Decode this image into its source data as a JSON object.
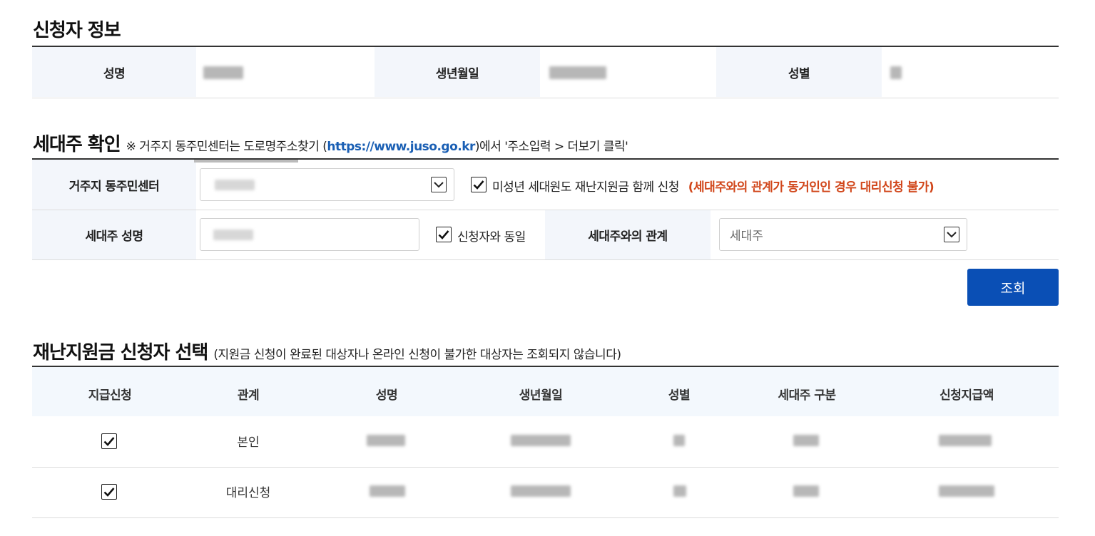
{
  "applicant": {
    "title": "신청자 정보",
    "name_label": "성명",
    "birth_label": "생년월일",
    "gender_label": "성별"
  },
  "household": {
    "title": "세대주 확인",
    "note_prefix": "※ 거주지 동주민센터는 도로명주소찾기 (",
    "note_link": "https://www.juso.go.kr",
    "note_suffix": ")에서 '주소입력 > 더보기 클릭'",
    "center_label": "거주지 동주민센터",
    "minor_check_label": "미성년 세대원도 재난지원금 함께 신청",
    "minor_warning": "(세대주와의 관계가 동거인인 경우 대리신청 불가)",
    "head_name_label": "세대주 성명",
    "same_as_applicant_label": "신청자와 동일",
    "relation_label": "세대주와의 관계",
    "relation_value": "세대주",
    "search_button": "조회"
  },
  "selection": {
    "title": "재난지원금 신청자 선택",
    "note": "(지원금 신청이 완료된 대상자나 온라인 신청이 불가한 대상자는 조회되지 않습니다)",
    "columns": [
      "지급신청",
      "관계",
      "성명",
      "생년월일",
      "성별",
      "세대주 구분",
      "신청지급액"
    ],
    "rows": [
      {
        "relation": "본인",
        "checked": true
      },
      {
        "relation": "대리신청",
        "checked": true
      }
    ]
  },
  "colors": {
    "accent": "#0a4fb5",
    "warning": "#d1461a",
    "header_bg": "#f3f6fb",
    "link": "#1a5fb4"
  }
}
